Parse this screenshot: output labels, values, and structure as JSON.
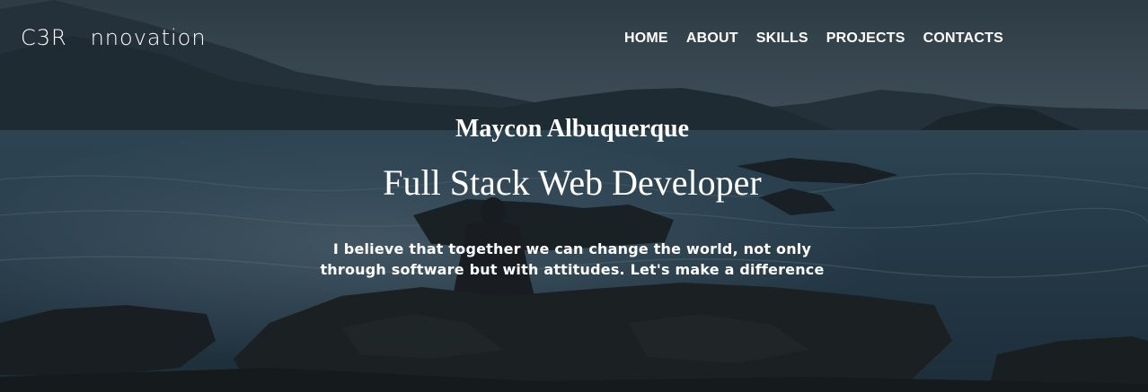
{
  "brand": {
    "logo_text": "C3R   nnovation"
  },
  "nav": {
    "items": [
      {
        "label": "HOME"
      },
      {
        "label": "ABOUT"
      },
      {
        "label": "SKILLS"
      },
      {
        "label": "PROJECTS"
      },
      {
        "label": "CONTACTS"
      }
    ]
  },
  "hero": {
    "name": "Maycon Albuquerque",
    "role": "Full Stack Web Developer",
    "tagline": "I believe that together we can change the world, not only through software but with attitudes. Let's make a difference"
  },
  "colors": {
    "text": "#ffffff",
    "sky": "#4f6470",
    "sea": "#2f4a5c",
    "rock": "#1d2323"
  }
}
